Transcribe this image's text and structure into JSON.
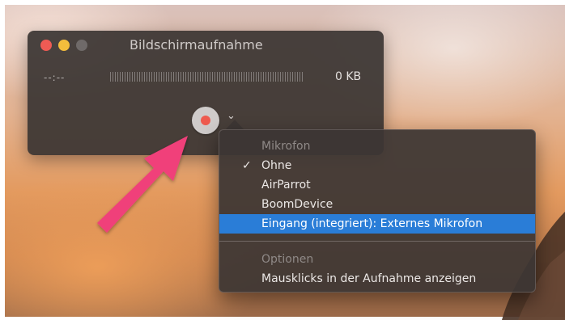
{
  "window": {
    "title": "Bildschirmaufnahme",
    "timecode": "--:--",
    "filesize": "0 KB"
  },
  "menu": {
    "section_microphone": "Mikrofon",
    "items": [
      {
        "label": "Ohne",
        "checked": true
      },
      {
        "label": "AirParrot",
        "checked": false
      },
      {
        "label": "BoomDevice",
        "checked": false
      },
      {
        "label": "Eingang (integriert): Externes Mikrofon",
        "checked": false,
        "highlighted": true
      }
    ],
    "section_options": "Optionen",
    "option_items": [
      {
        "label": "Mausklicks in der Aufnahme anzeigen"
      }
    ],
    "checkmark": "✓"
  },
  "colors": {
    "highlight": "#2a7dd7",
    "record_red": "#ee5a4e",
    "annotation_arrow": "#f0407a"
  }
}
